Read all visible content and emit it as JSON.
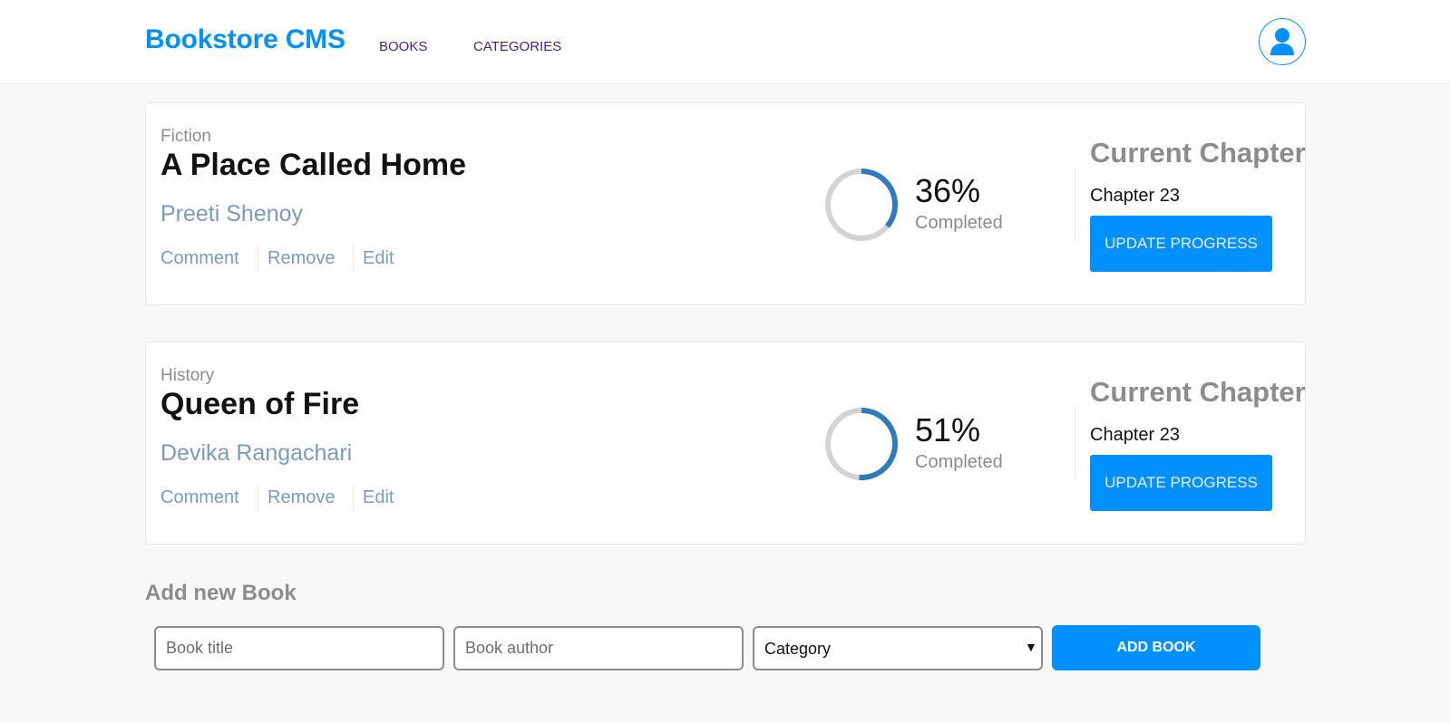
{
  "header": {
    "brand": "Bookstore CMS",
    "nav": [
      {
        "label": "BOOKS"
      },
      {
        "label": "CATEGORIES"
      }
    ],
    "avatar_icon": "user-icon"
  },
  "books": [
    {
      "category": "Fiction",
      "title": "A Place Called Home",
      "author": "Preeti Shenoy",
      "actions": {
        "comment": "Comment",
        "remove": "Remove",
        "edit": "Edit"
      },
      "progress_percent": 36,
      "percent_label": "36%",
      "completed_label": "Completed",
      "chapter_heading": "Current Chapter",
      "chapter": "Chapter 23",
      "update_label": "UPDATE PROGRESS"
    },
    {
      "category": "History",
      "title": "Queen of Fire",
      "author": "Devika Rangachari",
      "actions": {
        "comment": "Comment",
        "remove": "Remove",
        "edit": "Edit"
      },
      "progress_percent": 51,
      "percent_label": "51%",
      "completed_label": "Completed",
      "chapter_heading": "Current Chapter",
      "chapter": "Chapter 23",
      "update_label": "UPDATE PROGRESS"
    }
  ],
  "add_form": {
    "heading": "Add new Book",
    "title_placeholder": "Book title",
    "author_placeholder": "Book author",
    "category_selected": "Category",
    "submit_label": "ADD BOOK"
  },
  "colors": {
    "accent": "#0290ff",
    "ring_track": "#d3d3d3",
    "ring_fill": "#307bbe",
    "author_link": "#7a9bbf",
    "nav_link": "#4a1f8a"
  }
}
